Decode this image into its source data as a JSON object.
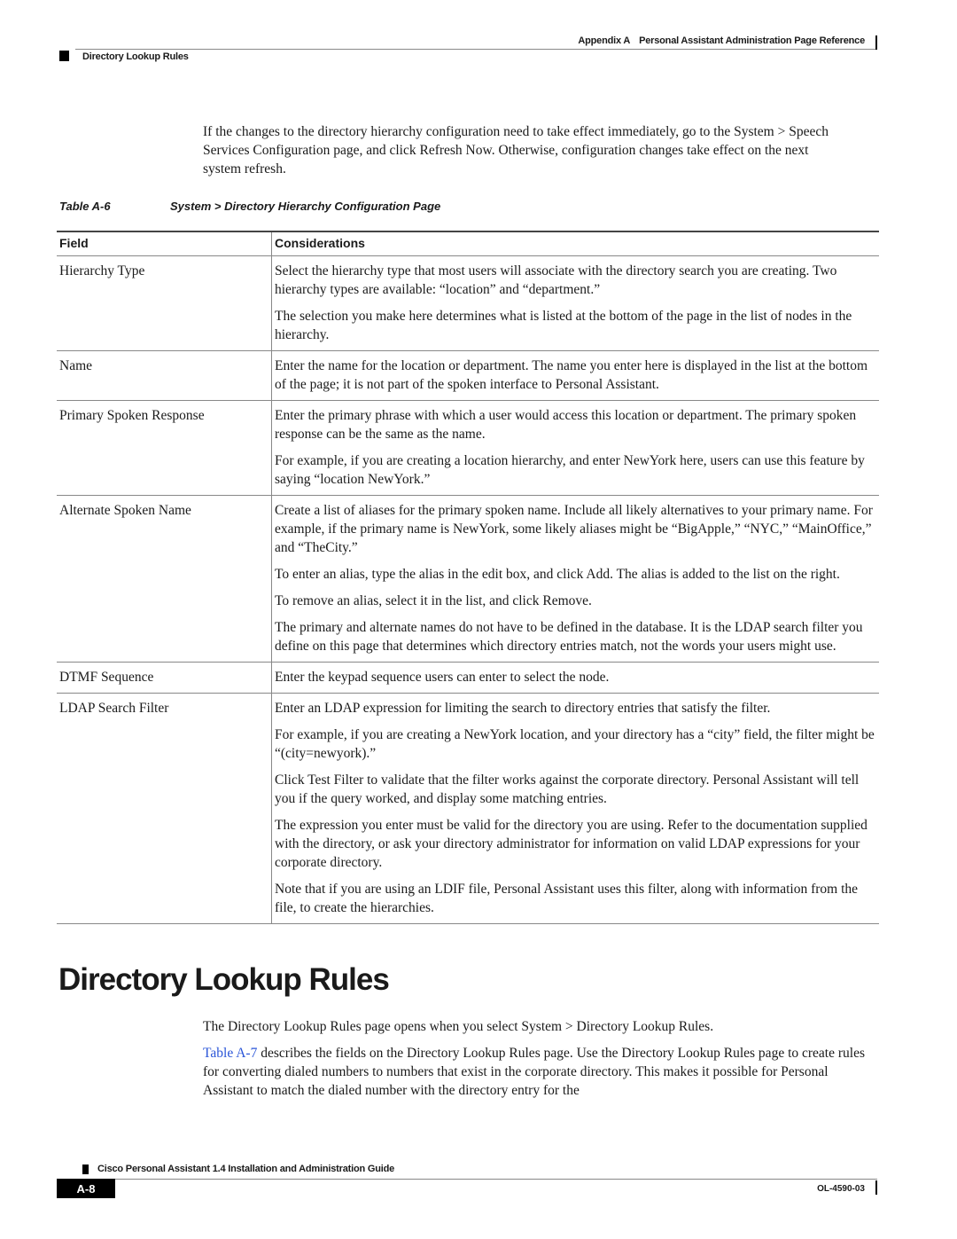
{
  "header": {
    "appendix": "Appendix A",
    "chapter_title": "Personal Assistant Administration Page Reference",
    "section": "Directory Lookup Rules"
  },
  "intro": "If the changes to the directory hierarchy configuration need to take effect immediately, go to the System > Speech Services Configuration page, and click Refresh Now. Otherwise, configuration changes take effect on the next system refresh.",
  "table": {
    "number": "Table A-6",
    "caption": "System > Directory Hierarchy Configuration Page",
    "columns": [
      "Field",
      "Considerations"
    ],
    "rows": [
      {
        "field": "Hierarchy Type",
        "paragraphs": [
          "Select the hierarchy type that most users will associate with the directory search you are creating. Two hierarchy types are available: “location” and “department.”",
          "The selection you make here determines what is listed at the bottom of the page in the list of nodes in the hierarchy."
        ]
      },
      {
        "field": "Name",
        "paragraphs": [
          "Enter the name for the location or department. The name you enter here is displayed in the list at the bottom of the page; it is not part of the spoken interface to Personal Assistant."
        ]
      },
      {
        "field": "Primary Spoken Response",
        "paragraphs": [
          "Enter the primary phrase with which a user would access this location or department. The primary spoken response can be the same as the name.",
          "For example, if you are creating a location hierarchy, and enter NewYork here, users can use this feature by saying “location NewYork.”"
        ]
      },
      {
        "field": "Alternate Spoken Name",
        "paragraphs": [
          "Create a list of aliases for the primary spoken name. Include all likely alternatives to your primary name. For example, if the primary name is NewYork, some likely aliases might be “BigApple,” “NYC,” “MainOffice,” and “TheCity.”",
          "To enter an alias, type the alias in the edit box, and click Add. The alias is added to the list on the right.",
          "To remove an alias, select it in the list, and click Remove.",
          "The primary and alternate names do not have to be defined in the database. It is the LDAP search filter you define on this page that determines which directory entries match, not the words your users might use."
        ]
      },
      {
        "field": "DTMF Sequence",
        "paragraphs": [
          "Enter the keypad sequence users can enter to select the node."
        ]
      },
      {
        "field": "LDAP Search Filter",
        "paragraphs": [
          "Enter an LDAP expression for limiting the search to directory entries that satisfy the filter.",
          "For example, if you are creating a NewYork location, and your directory has a “city” field, the filter might be “(city=newyork).”",
          "Click Test Filter to validate that the filter works against the corporate directory. Personal Assistant will tell you if the query worked, and display some matching entries.",
          "The expression you enter must be valid for the directory you are using. Refer to the documentation supplied with the directory, or ask your directory administrator for information on valid LDAP expressions for your corporate directory.",
          "Note that if you are using an LDIF file, Personal Assistant uses this filter, along with information from the file, to create the hierarchies."
        ]
      }
    ]
  },
  "section": {
    "title": "Directory Lookup Rules",
    "para1": "The Directory Lookup Rules page opens when you select System > Directory Lookup Rules.",
    "para2_link": "Table A-7",
    "para2_rest": " describes the fields on the Directory Lookup Rules page. Use the Directory Lookup Rules page to create rules for converting dialed numbers to numbers that exist in the corporate directory. This makes it possible for Personal Assistant to match the dialed number with the directory entry for the"
  },
  "footer": {
    "guide_title": "Cisco Personal Assistant 1.4 Installation and Administration Guide",
    "page_number": "A-8",
    "doc_number": "OL-4590-03"
  },
  "colors": {
    "link": "#2a55d8"
  }
}
